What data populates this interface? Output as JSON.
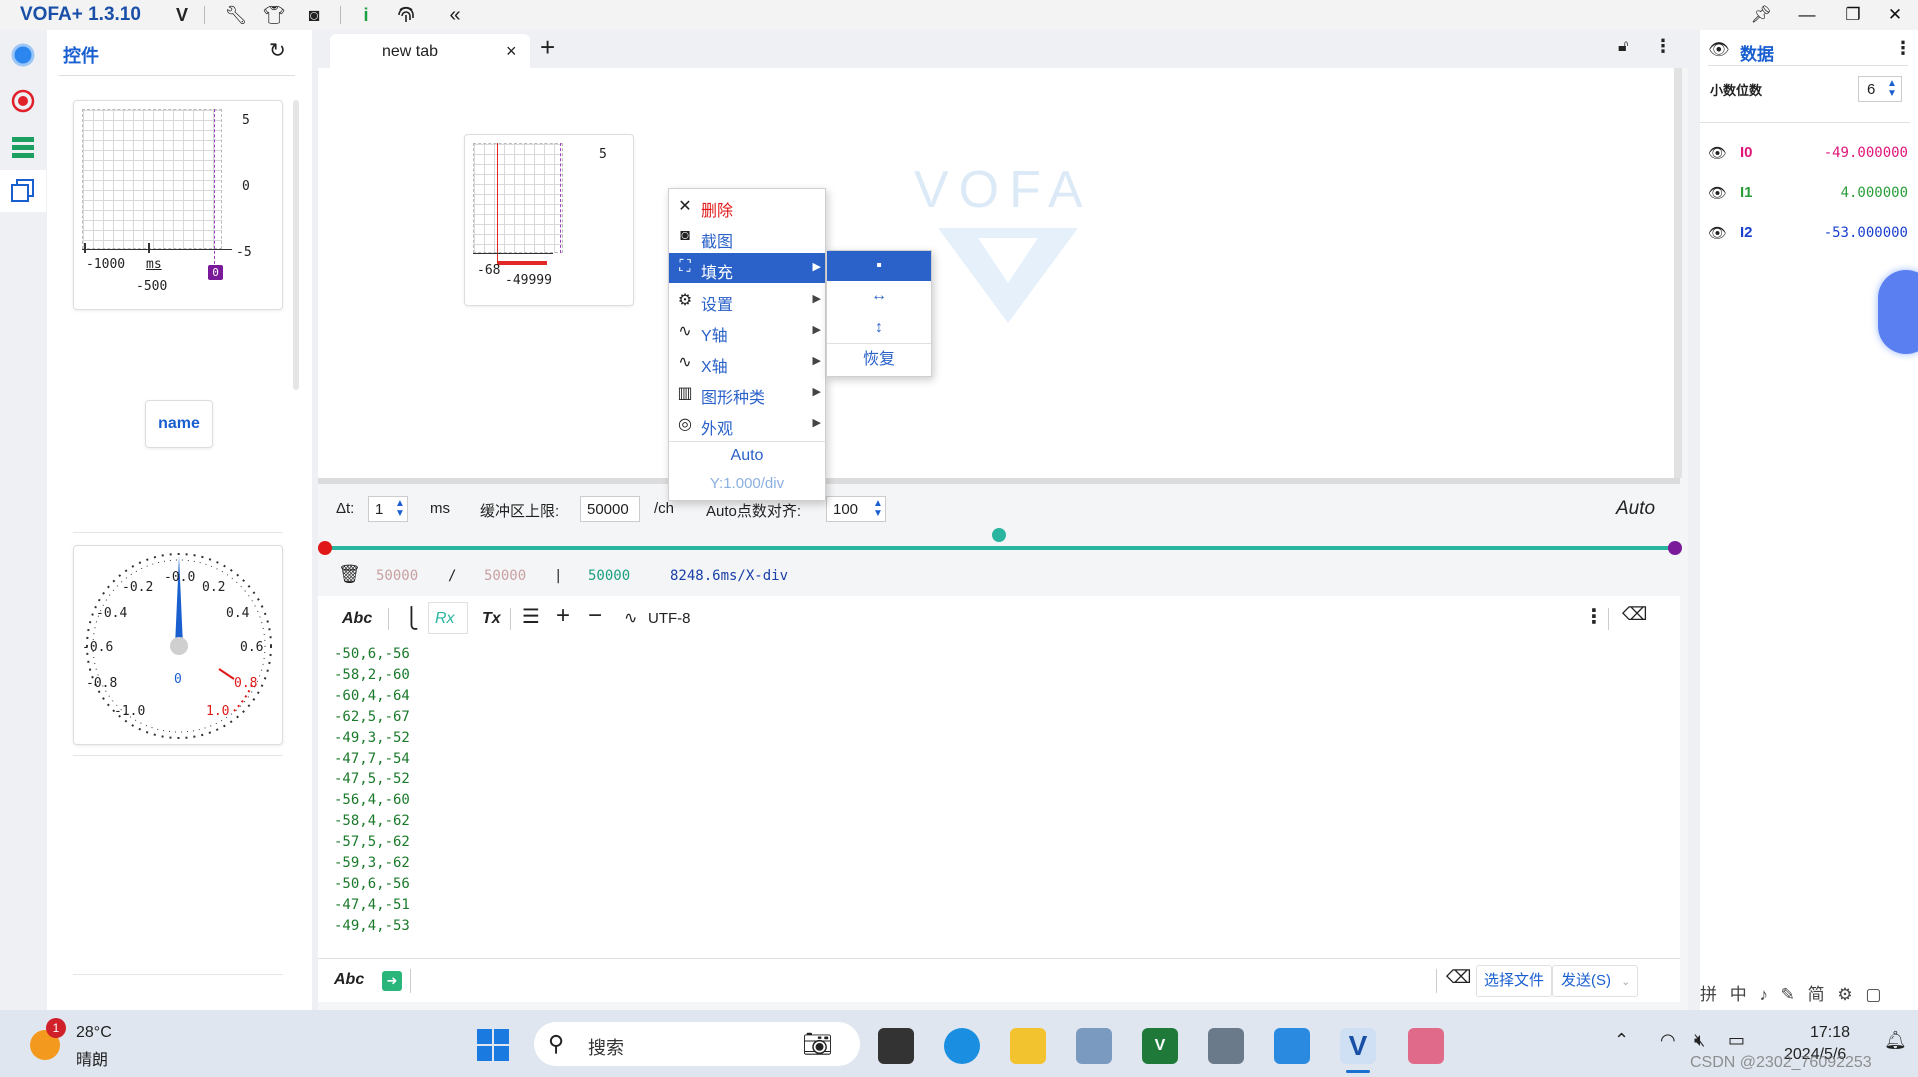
{
  "titlebar": {
    "app_title": "VOFA+ 1.3.10",
    "icons": [
      "vofa-logo-icon",
      "wrench-icon",
      "shirt-icon",
      "screenshot-icon",
      "info-icon",
      "fingerprint-icon",
      "collapse-icon"
    ],
    "window_buttons": [
      "pin-icon",
      "minimize-icon",
      "restore-icon",
      "close-icon"
    ]
  },
  "leftstrip": {
    "icons": [
      "connection-status-icon",
      "record-icon",
      "command-list-icon",
      "widgets-icon"
    ]
  },
  "widgets_panel": {
    "title": "控件",
    "waveform_widget": {
      "y_ticks": [
        "5",
        "0",
        "-5"
      ],
      "x_ticks": [
        "-1000",
        "ms",
        "-500"
      ],
      "cursor_badge": "0"
    },
    "name_button": "name",
    "gauge_widget": {
      "scale_labels": [
        "-0.2",
        "-0.0",
        "0.2",
        "-0.4",
        "0.4",
        "-0.6",
        "0.6",
        "-0.8",
        "0.8",
        "-1.0",
        "1.0"
      ],
      "value": "0"
    }
  },
  "tabs": {
    "items": [
      {
        "label": "new tab",
        "close": "×"
      }
    ],
    "add": "+"
  },
  "canvas": {
    "mini_waveform": {
      "y_tick": "5",
      "x_tick_left": "-68",
      "x_tick_mid": "-49999"
    },
    "watermark": "VOFA"
  },
  "context_menu": {
    "items": [
      {
        "icon": "✕",
        "label": "删除",
        "danger": true,
        "arrow": false
      },
      {
        "icon": "◙",
        "label": "截图",
        "arrow": false
      },
      {
        "icon": "⛶",
        "label": "填充",
        "arrow": true,
        "active": true
      },
      {
        "icon": "⚙",
        "label": "设置",
        "arrow": true
      },
      {
        "icon": "∿",
        "label": "Y轴",
        "arrow": true
      },
      {
        "icon": "∿",
        "label": "X轴",
        "arrow": true
      },
      {
        "icon": "▥",
        "label": "图形种类",
        "arrow": true
      },
      {
        "icon": "◎",
        "label": "外观",
        "arrow": true
      }
    ],
    "auto_label": "Auto",
    "ydiv_label": "Y:1.000/div",
    "submenu": [
      "▪",
      "↔",
      "↕",
      "恢复"
    ]
  },
  "controls": {
    "dt_label": "Δt:",
    "dt_value": "1",
    "dt_unit": "ms",
    "buffer_label": "缓冲区上限:",
    "buffer_value": "50000",
    "buffer_unit": "/ch",
    "align_label": "Auto点数对齐:",
    "align_value": "100",
    "auto_label": "Auto"
  },
  "buffer_status": {
    "used": "50000",
    "slash": "/",
    "total": "50000",
    "pipe": "|",
    "points": "50000",
    "xdiv": "8248.6ms/X-div"
  },
  "rx_toolbar": {
    "abc": "Abc",
    "rx": "Rx",
    "tx": "Tx",
    "encoding": "UTF-8"
  },
  "rx_lines": [
    "-50,6,-56",
    "-58,2,-60",
    "-60,4,-64",
    "-62,5,-67",
    "-49,3,-52",
    "-47,7,-54",
    "-47,5,-52",
    "-56,4,-60",
    "-58,4,-62",
    "-57,5,-62",
    "-59,3,-62",
    "-50,6,-56",
    "-47,4,-51",
    "-49,4,-53"
  ],
  "send_bar": {
    "abc": "Abc",
    "choose_file": "选择文件",
    "send": "发送(S)"
  },
  "data_panel": {
    "title": "数据",
    "decimals_label": "小数位数",
    "decimals_value": "6",
    "channels": [
      {
        "name": "I0",
        "value": "-49.000000",
        "color": "#e0157a"
      },
      {
        "name": "I1",
        "value": "4.000000",
        "color": "#2a9d3a"
      },
      {
        "name": "I2",
        "value": "-53.000000",
        "color": "#1a3fd0"
      }
    ]
  },
  "ime_bar": "拼 中 ♪ ✎ 简 ⚙ ▢",
  "taskbar": {
    "weather_temp": "28°C",
    "weather_desc": "晴朗",
    "weather_badge": "1",
    "search_placeholder": "搜索",
    "time": "17:18",
    "date": "2024/5/6",
    "watermark": "CSDN @2302_76092253"
  }
}
